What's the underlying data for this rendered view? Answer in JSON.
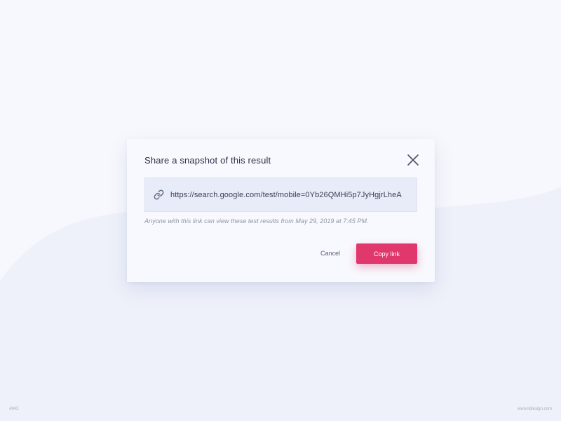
{
  "dialog": {
    "title": "Share a snapshot of this result",
    "close_icon": "close-icon",
    "link": {
      "icon": "link-icon",
      "url": "https://search.google.com/test/mobile=0Yb26QMHi5p7JyHgjrLheA"
    },
    "note": "Anyone with this link can view these test results from May 29, 2019 at 7:45 PM.",
    "cancel_label": "Cancel",
    "copy_label": "Copy link"
  },
  "footer": {
    "shot_number": "#843",
    "site": "www.ildiesign.com"
  },
  "colors": {
    "background": "#f7f8fd",
    "background_wave": "#eef1fa",
    "dialog": "#f8f9fe",
    "link_field": "#e8ebf8",
    "primary_button": "#e0386c",
    "title_text": "#2c3045",
    "note_text": "#8f94a8"
  }
}
